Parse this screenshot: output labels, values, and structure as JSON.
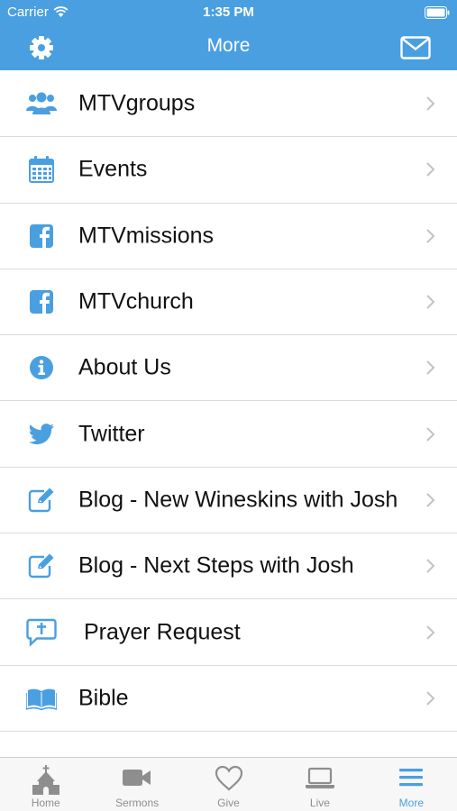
{
  "status": {
    "carrier": "Carrier",
    "time": "1:35 PM"
  },
  "header": {
    "title": "More",
    "left_icon": "gear-icon",
    "right_icon": "mail-icon"
  },
  "colors": {
    "accent": "#4a9fe0",
    "separator": "#dcdcdc",
    "tab_inactive": "#8e8e8e"
  },
  "menu": {
    "items": [
      {
        "label": "MTVgroups",
        "icon": "users-icon"
      },
      {
        "label": "Events",
        "icon": "calendar-icon"
      },
      {
        "label": "MTVmissions",
        "icon": "facebook-icon"
      },
      {
        "label": "MTVchurch",
        "icon": "facebook-icon"
      },
      {
        "label": "About Us",
        "icon": "info-icon"
      },
      {
        "label": "Twitter",
        "icon": "twitter-icon"
      },
      {
        "label": "Blog - New Wineskins with Josh",
        "icon": "edit-icon"
      },
      {
        "label": "Blog - Next Steps with Josh",
        "icon": "edit-icon"
      },
      {
        "label": "Prayer Request",
        "icon": "prayer-chat-icon"
      },
      {
        "label": "Bible",
        "icon": "book-icon"
      }
    ]
  },
  "tabs": {
    "items": [
      {
        "label": "Home",
        "icon": "church-icon",
        "active": false
      },
      {
        "label": "Sermons",
        "icon": "video-camera-icon",
        "active": false
      },
      {
        "label": "Give",
        "icon": "heart-icon",
        "active": false
      },
      {
        "label": "Live",
        "icon": "laptop-icon",
        "active": false
      },
      {
        "label": "More",
        "icon": "menu-icon",
        "active": true
      }
    ]
  }
}
